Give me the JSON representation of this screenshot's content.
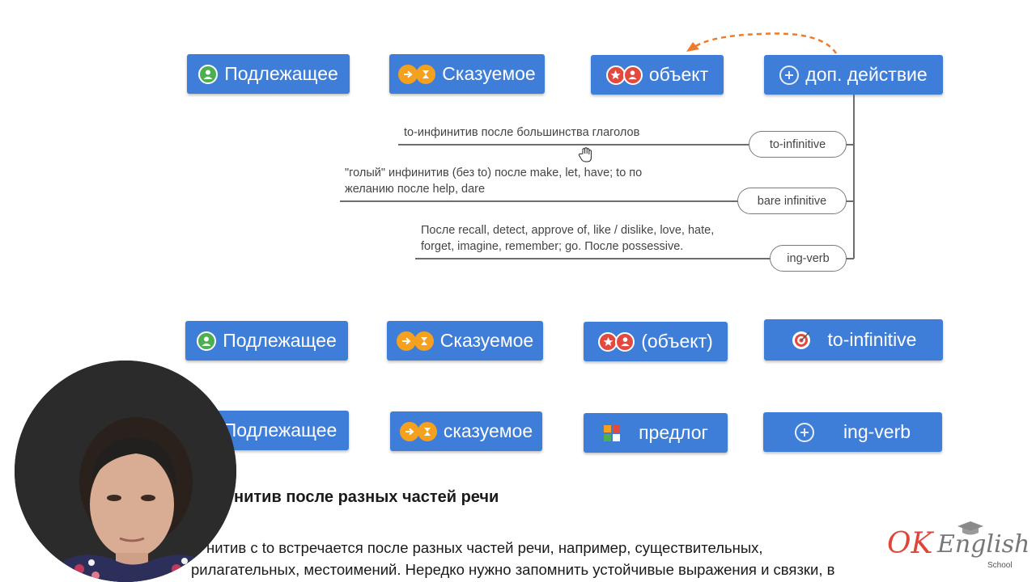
{
  "diagram1": {
    "subject": "Подлежащее",
    "predicate": "Сказуемое",
    "object": "объект",
    "extra": "доп. действие",
    "branches": [
      {
        "tag": "to-infinitive",
        "note_lines": [
          "to-инфинитив после большинства глаголов"
        ]
      },
      {
        "tag": "bare infinitive",
        "note_lines": [
          "\"голый\" инфинитив (без to) после  make, let, have; to по",
          "желанию после help, dare"
        ]
      },
      {
        "tag": "ing-verb",
        "note_lines": [
          "После recall, detect, approve of, like / dislike, love, hate,",
          "forget, imagine, remember; go. После possessive."
        ]
      }
    ]
  },
  "row2": {
    "subject": "Подлежащее",
    "predicate": "Сказуемое",
    "object": "(объект)",
    "infinitive": "to-infinitive"
  },
  "row3": {
    "subject": "Подлежащее",
    "predicate": "сказуемое",
    "preposition": "предлог",
    "gerund": "ing-verb"
  },
  "article": {
    "heading": "нитив после разных частей речи",
    "line1": "нитив с to встречается после разных частей речи, например, существительных,",
    "line2": "рилагательных, местоимений. Нередко нужно запомнить устойчивые выражения и связки, в"
  },
  "logo": {
    "ok": "OK",
    "english": "English",
    "school": "School"
  },
  "colors": {
    "pill": "#3f7ed8",
    "arrow": "#f07a2a",
    "logo_red": "#e0453a",
    "logo_gray": "#777777"
  },
  "icons": [
    "person-icon",
    "arrow-icon",
    "hourglass-icon",
    "star-icon",
    "plus-icon",
    "target-icon",
    "blocks-icon",
    "hand-cursor-icon"
  ]
}
